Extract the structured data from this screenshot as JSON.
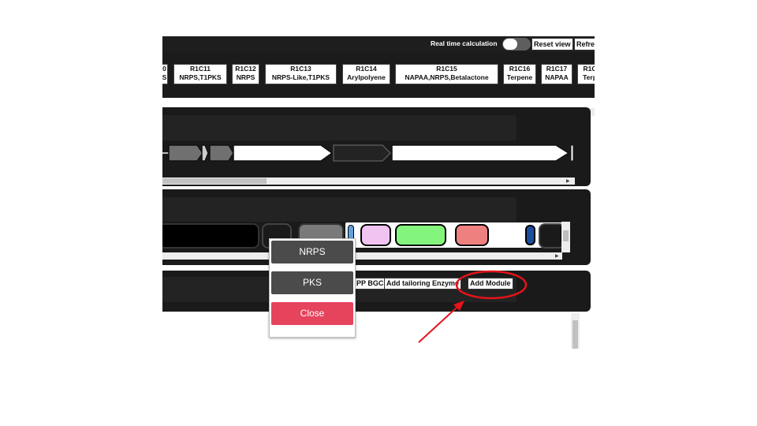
{
  "topbar": {
    "realtime_label": "Real time calculation",
    "reset_view": "Reset view",
    "refresh": "Refre"
  },
  "regions": [
    {
      "id": "0",
      "type": "S"
    },
    {
      "id": "R1C11",
      "type": "NRPS,T1PKS"
    },
    {
      "id": "R1C12",
      "type": "NRPS"
    },
    {
      "id": "R1C13",
      "type": "NRPS-Like,T1PKS"
    },
    {
      "id": "R1C14",
      "type": "Arylpolyene"
    },
    {
      "id": "R1C15",
      "type": "NAPAA,NRPS,Betalactone"
    },
    {
      "id": "R1C16",
      "type": "Terpene"
    },
    {
      "id": "R1C17",
      "type": "NAPAA"
    },
    {
      "id": "R1C",
      "type": "Terp"
    }
  ],
  "tools": {
    "ripp_bgc": "PP BGC",
    "add_tailoring": "Add tailoring Enzyme",
    "add_module": "Add Module"
  },
  "popup": {
    "nrps": "NRPS",
    "pks": "PKS",
    "close": "Close"
  },
  "colors": {
    "accent_red": "#e6435d",
    "annotation_red": "#e5141a",
    "domain_green": "#84f57c",
    "domain_pink": "#ef8080",
    "domain_lavender": "#f0c3f0",
    "domain_blue": "#1a4fa0"
  }
}
